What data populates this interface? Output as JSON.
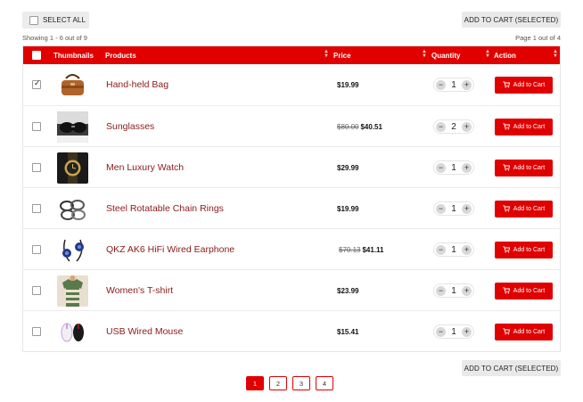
{
  "toolbar": {
    "select_all_label": "SELECT ALL",
    "add_selected_label": "ADD TO CART (SELECTED)"
  },
  "info": {
    "showing": "Showing 1 - 6 out of 9",
    "page": "Page 1 out of 4"
  },
  "table": {
    "headers": {
      "thumbnails": "Thumbnails",
      "products": "Products",
      "price": "Price",
      "quantity": "Quantity",
      "action": "Action"
    },
    "add_to_cart_label": "Add to Cart",
    "rows": [
      {
        "name": "Hand-held Bag",
        "old_price": "",
        "price": "$19.99",
        "qty": "1",
        "checked": true,
        "icon": "bag-icon"
      },
      {
        "name": "Sunglasses",
        "old_price": "$80.00",
        "price": "$40.51",
        "qty": "2",
        "checked": false,
        "icon": "sunglasses-icon"
      },
      {
        "name": "Men Luxury Watch",
        "old_price": "",
        "price": "$29.99",
        "qty": "1",
        "checked": false,
        "icon": "watch-icon"
      },
      {
        "name": "Steel Rotatable Chain Rings",
        "old_price": "",
        "price": "$19.99",
        "qty": "1",
        "checked": false,
        "icon": "rings-icon"
      },
      {
        "name": "QKZ AK6 HiFi Wired Earphone",
        "old_price": "$70.13",
        "price": "$41.11",
        "qty": "1",
        "checked": false,
        "icon": "earphone-icon"
      },
      {
        "name": "Women's T-shirt",
        "old_price": "",
        "price": "$23.99",
        "qty": "1",
        "checked": false,
        "icon": "tshirt-icon"
      },
      {
        "name": "USB Wired Mouse",
        "old_price": "",
        "price": "$15.41",
        "qty": "1",
        "checked": false,
        "icon": "mouse-icon"
      }
    ]
  },
  "pagination": {
    "pages": [
      "1",
      "2",
      "3",
      "4"
    ],
    "active": "1"
  },
  "colors": {
    "accent": "#e00000",
    "product_link": "#8b1a1a"
  }
}
